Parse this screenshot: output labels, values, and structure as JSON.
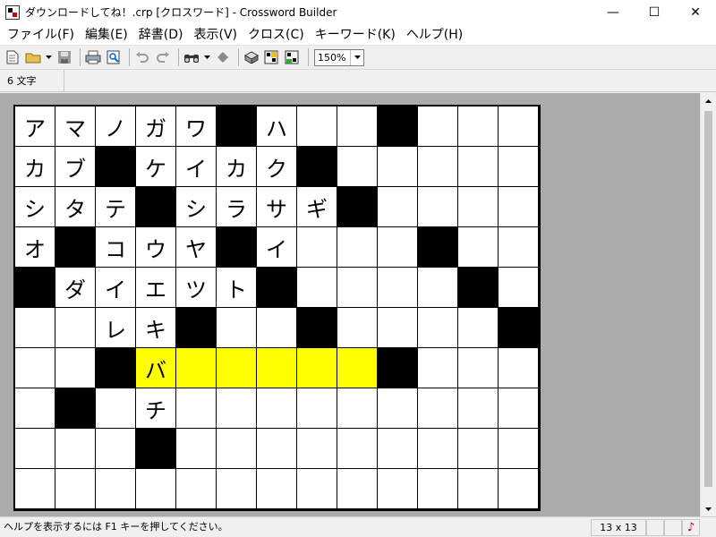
{
  "window": {
    "title": "ダウンロードしてね！.crp [クロスワード] - Crossword Builder",
    "minimize": "—",
    "maximize": "☐",
    "close": "✕"
  },
  "menu": [
    "ファイル(F)",
    "編集(E)",
    "辞書(D)",
    "表示(V)",
    "クロス(C)",
    "キーワード(K)",
    "ヘルプ(H)"
  ],
  "toolbar": {
    "icons": [
      "new-document-icon",
      "open-folder-icon",
      "save-icon",
      "print-icon",
      "print-preview-icon",
      "undo-icon",
      "redo-icon",
      "find-binoculars-icon",
      "eraser-icon",
      "cube-icon",
      "export-icon",
      "settings-icon"
    ],
    "zoom": "150%"
  },
  "info": {
    "word_length": "6 文字"
  },
  "grid": {
    "rows": [
      [
        "ア",
        "マ",
        "ノ",
        "ガ",
        "ワ",
        "#",
        "ハ",
        "",
        "",
        "#",
        "",
        "",
        ""
      ],
      [
        "カ",
        "ブ",
        "#",
        "ケ",
        "イ",
        "カ",
        "ク",
        "#",
        "",
        "",
        "",
        "",
        ""
      ],
      [
        "シ",
        "タ",
        "テ",
        "#",
        "シ",
        "ラ",
        "サ",
        "ギ",
        "#",
        "",
        "",
        "",
        ""
      ],
      [
        "オ",
        "#",
        "コ",
        "ウ",
        "ヤ",
        "#",
        "イ",
        "",
        "",
        "",
        "#",
        "",
        ""
      ],
      [
        "#",
        "ダ",
        "イ",
        "エ",
        "ツ",
        "ト",
        "#",
        "",
        "",
        "",
        "",
        "#",
        ""
      ],
      [
        "",
        "",
        "レ",
        "キ",
        "#",
        "",
        "",
        "#",
        "",
        "",
        "",
        "",
        "#"
      ],
      [
        "",
        "",
        "#",
        "バ",
        "",
        "",
        "",
        "",
        "",
        "#",
        "",
        "",
        ""
      ],
      [
        "",
        "#",
        "",
        "チ",
        "",
        "",
        "",
        "",
        "",
        "",
        "",
        "",
        ""
      ],
      [
        "",
        "",
        "",
        "#",
        "",
        "",
        "",
        "",
        "",
        "",
        "",
        "",
        ""
      ],
      [
        "",
        "",
        "",
        "",
        "",
        "",
        "",
        "",
        "",
        "",
        "",
        "",
        ""
      ]
    ],
    "highlight": {
      "row": 6,
      "from": 3,
      "to": 8,
      "color": "#ffff00"
    }
  },
  "status": {
    "message": "ヘルプを表示するには F1 キーを押してください。",
    "size": "13 x 13",
    "panel2": "",
    "panel3": "",
    "sound_icon": "music-note-icon"
  }
}
